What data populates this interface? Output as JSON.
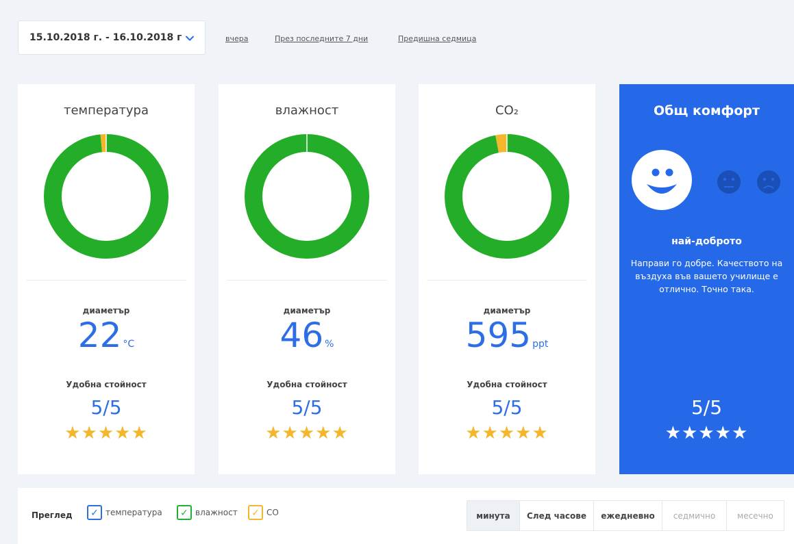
{
  "filter": {
    "date_range": "15.10.2018 г. - 16.10.2018 г",
    "quick_links": [
      "вчера",
      "През последните 7 дни",
      "Предишна седмица"
    ]
  },
  "cards": [
    {
      "title": "температура",
      "avg_label": "диаметър",
      "avg_value": "22",
      "unit": "°C",
      "comfort_label": "Удобна стойност",
      "score": "5/5",
      "stars": 5,
      "ring": {
        "good": 0.985,
        "warn": 0.015
      }
    },
    {
      "title": "влажност",
      "avg_label": "диаметър",
      "avg_value": "46",
      "unit": "%",
      "comfort_label": "Удобна стойност",
      "score": "5/5",
      "stars": 5,
      "ring": {
        "good": 1.0,
        "warn": 0.0
      }
    },
    {
      "title": "CO₂",
      "avg_label": "диаметър",
      "avg_value": "595",
      "unit": "ppt",
      "comfort_label": "Удобна стойност",
      "score": "5/5",
      "stars": 5,
      "ring": {
        "good": 0.97,
        "warn": 0.03
      }
    }
  ],
  "overall": {
    "title": "Общ комфорт",
    "rating_label": "най-доброто",
    "message": "Направи го добре. Качеството на въздуха във вашето училище е отлично. Точно така.",
    "score": "5/5",
    "stars": 5,
    "faces": [
      "happy-face-icon",
      "neutral-face-icon",
      "sad-face-icon"
    ]
  },
  "bottom": {
    "overview_label": "Преглед",
    "legend": [
      {
        "label": "температура",
        "color": "#2d6ee6",
        "checked": true
      },
      {
        "label": "влажност",
        "color": "#22b030",
        "checked": true
      },
      {
        "label": "CO",
        "color": "#f4b72c",
        "checked": true
      }
    ],
    "periods": [
      "минута",
      "След часове",
      "ежедневно",
      "седмично",
      "месечно"
    ],
    "active_period": "минута"
  },
  "colors": {
    "good": "#23ad28",
    "warn": "#f4b72c",
    "accent": "#2d6ee6",
    "overall_bg": "#2569e9"
  }
}
